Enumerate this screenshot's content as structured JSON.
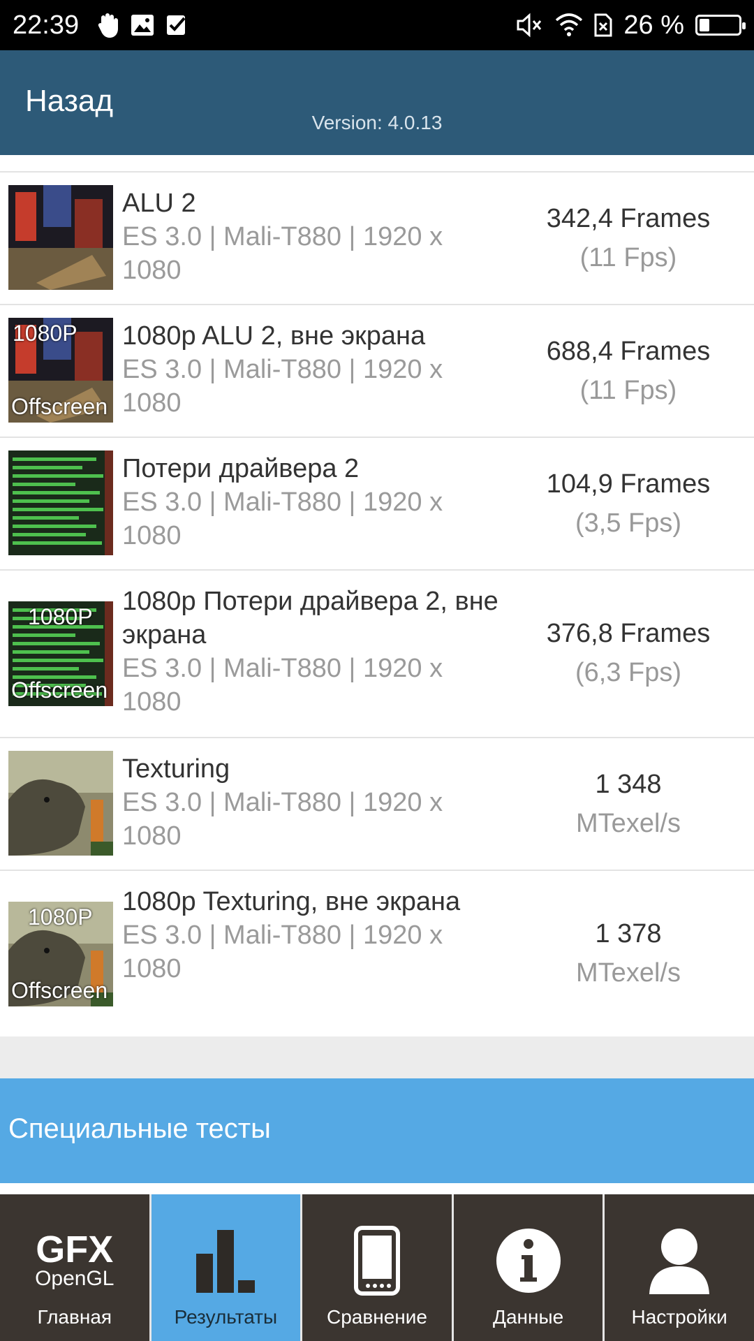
{
  "status_bar": {
    "time": "22:39",
    "battery_text": "26 %",
    "battery_level": 0.26,
    "icons_left": [
      "hand-icon",
      "image-icon",
      "check-icon"
    ],
    "icons_right": [
      "mute-icon",
      "wifi-icon",
      "sim-icon"
    ]
  },
  "header": {
    "back_label": "Назад",
    "version": "Version: 4.0.13"
  },
  "tests": [
    {
      "thumb": "city",
      "badge": "",
      "title": "ALU 2",
      "subtitle": "ES 3.0 | Mali-T880 | 1920 x 1080",
      "result_main": "342,4 Frames",
      "result_sub": "(11 Fps)"
    },
    {
      "thumb": "city",
      "badge": "1080P",
      "badge2": "Offscreen",
      "title": "1080p ALU 2, вне экрана",
      "subtitle": "ES 3.0 | Mali-T880 | 1920 x 1080",
      "result_main": "688,4 Frames",
      "result_sub": "(11 Fps)"
    },
    {
      "thumb": "bars",
      "badge": "",
      "title": "Потери драйвера 2",
      "subtitle": "ES 3.0 | Mali-T880 | 1920 x 1080",
      "result_main": "104,9 Frames",
      "result_sub": "(3,5 Fps)"
    },
    {
      "thumb": "bars",
      "badge": "1080P",
      "badge2": "Offscreen",
      "title": "1080p Потери драйвера 2, вне экрана",
      "subtitle": "ES 3.0 | Mali-T880 | 1920 x 1080",
      "result_main": "376,8 Frames",
      "result_sub": "(6,3 Fps)"
    },
    {
      "thumb": "dino",
      "badge": "",
      "title": "Texturing",
      "subtitle": "ES 3.0 | Mali-T880 | 1920 x 1080",
      "result_main": "1 348",
      "result_sub": "MTexel/s"
    },
    {
      "thumb": "dino",
      "badge": "1080P",
      "badge2": "Offscreen",
      "title": "1080p Texturing, вне экрана",
      "subtitle": "ES 3.0 | Mali-T880 | 1920 x 1080",
      "result_main": "1 378",
      "result_sub": "MTexel/s"
    }
  ],
  "special_section": "Специальные тесты",
  "nav": {
    "logo_top": "GFX",
    "logo_bottom": "OpenGL",
    "items": [
      {
        "label": "Главная",
        "icon": "gfx-logo-icon"
      },
      {
        "label": "Результаты",
        "icon": "bar-chart-icon",
        "active": true
      },
      {
        "label": "Сравнение",
        "icon": "phone-icon"
      },
      {
        "label": "Данные",
        "icon": "info-icon"
      },
      {
        "label": "Настройки",
        "icon": "user-icon"
      }
    ]
  }
}
